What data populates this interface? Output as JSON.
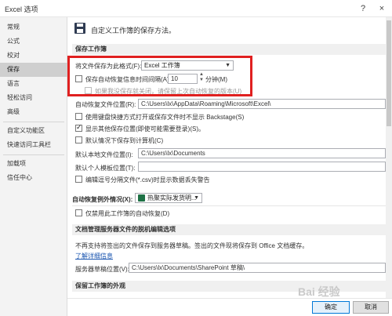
{
  "window": {
    "title": "Excel 选项",
    "help_icon": "?",
    "close_icon": "×"
  },
  "sidebar": {
    "items": [
      {
        "label": "常规"
      },
      {
        "label": "公式"
      },
      {
        "label": "校对"
      },
      {
        "label": "保存",
        "active": true
      },
      {
        "label": "语言"
      },
      {
        "label": "轻松访问"
      },
      {
        "label": "高级"
      },
      {
        "label": "自定义功能区"
      },
      {
        "label": "快速访问工具栏"
      },
      {
        "label": "加载项"
      },
      {
        "label": "信任中心"
      }
    ]
  },
  "header": {
    "text": "自定义工作簿的保存方法。"
  },
  "save_workbooks": {
    "section_title": "保存工作簿",
    "format_label": "将文件保存为此格式(F):",
    "format_value": "Excel 工作簿",
    "autorecover_label": "保存自动恢复信息时间间隔(A)",
    "autorecover_checked": false,
    "autorecover_minutes": "10",
    "minutes_label": "分钟(M)",
    "keep_last_label": "如果我没保存就关闭，请保留上次自动恢复的版本(U)",
    "keep_last_checked": false,
    "autorecover_location_label": "自动恢复文件位置(R):",
    "autorecover_location_value": "C:\\Users\\lx\\AppData\\Roaming\\Microsoft\\Excel\\",
    "no_backstage_label": "使用键盘快捷方式打开或保存文件时不显示 Backstage(S)",
    "no_backstage_checked": false,
    "show_more_label": "显示其他保存位置(即使可能需要登录)(S)。",
    "show_more_checked": true,
    "save_to_computer_label": "默认情况下保存到计算机(C)",
    "save_to_computer_checked": false,
    "default_local_label": "默认本地文件位置(I):",
    "default_local_value": "C:\\Users\\lx\\Documents",
    "default_template_label": "默认个人模板位置(T):",
    "default_template_value": "",
    "csv_warning_label": "编辑逗号分隔文件(*.csv)时显示数据丢失警告",
    "csv_warning_checked": false
  },
  "autorecover_exceptions": {
    "label": "自动恢复例外情况(X):",
    "workbook_value": "热聚实际发货明...",
    "disable_label": "仅禁用此工作簿的自动恢复(D)",
    "disable_checked": false
  },
  "offline_editing": {
    "section_title": "文档管理服务器文件的脱机编辑选项",
    "description": "不再支持将签出的文件保存到服务器草稿。签出的文件现将保存到 Office 文档缓存。",
    "learn_more": "了解详细信息",
    "drafts_label": "服务器草稿位置(V):",
    "drafts_value": "C:\\Users\\lx\\Documents\\SharePoint 草稿\\"
  },
  "appearance": {
    "section_title": "保留工作簿的外观"
  },
  "footer": {
    "ok_label": "确定",
    "cancel_label": "取消"
  },
  "watermark": {
    "text": "Bai 经验"
  },
  "colors": {
    "highlight": "#e02020",
    "active_nav": "#cfcfcf",
    "section_bg": "#f0f0f0",
    "link": "#1a55b0"
  }
}
